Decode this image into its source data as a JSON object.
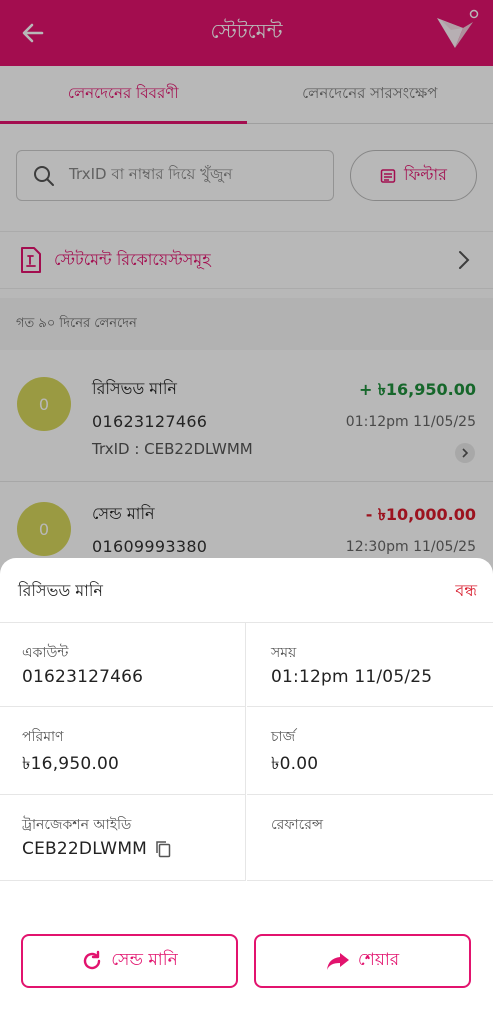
{
  "header": {
    "title": "স্টেটমেন্ট"
  },
  "tabs": [
    {
      "label": "লেনদেনের বিবরণী",
      "active": true
    },
    {
      "label": "লেনদেনের সারসংক্ষেপ",
      "active": false
    }
  ],
  "search": {
    "placeholder": "TrxID বা নাম্বার দিয়ে খুঁজুন"
  },
  "filter": {
    "label": "ফিল্টার"
  },
  "statement_request": {
    "label": "স্টেটমেন্ট রিকোয়েস্টসমূহ"
  },
  "section": {
    "label": "গত ৯০ দিনের লেনদেন"
  },
  "transactions": [
    {
      "avatar": "0",
      "type": "রিসিভড মানি",
      "number": "01623127466",
      "trx": "TrxID : CEB22DLWMM",
      "amount": "+ ৳16,950.00",
      "time": "01:12pm 11/05/25"
    },
    {
      "avatar": "0",
      "type": "সেন্ড মানি",
      "number": "01609993380",
      "amount": "- ৳10,000.00",
      "time": "12:30pm 11/05/25"
    }
  ],
  "sheet": {
    "title": "রিসিভড মানি",
    "close": "বন্ধ",
    "account_label": "একাউন্ট",
    "account_value": "01623127466",
    "time_label": "সময়",
    "time_value": "01:12pm 11/05/25",
    "amount_label": "পরিমাণ",
    "amount_value": "৳16,950.00",
    "charge_label": "চার্জ",
    "charge_value": "৳0.00",
    "trxid_label": "ট্রানজেকশন আইডি",
    "trxid_value": "CEB22DLWMM",
    "reference_label": "রেফারেন্স",
    "send_money_button": "সেন্ড মানি",
    "share_button": "শেয়ার"
  },
  "colors": {
    "brand": "#e2136e",
    "credit": "#1f8f3c",
    "debit": "#d81b2c"
  }
}
